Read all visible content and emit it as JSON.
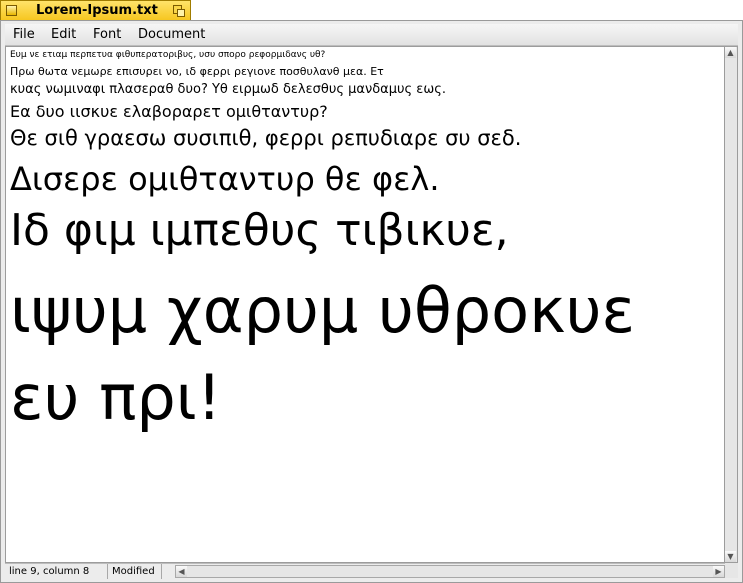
{
  "window": {
    "title": "Lorem-Ipsum.txt"
  },
  "menu": {
    "items": [
      "File",
      "Edit",
      "Font",
      "Document"
    ]
  },
  "document": {
    "lines": [
      "Ευμ νε ετιαμ περπετυα φιθυπερατοριβυς, υσυ σπορο ρεφορμιδανς υθ?",
      "Πρω θωτα νεμωρε επισυρει νο, ιδ φερρι ρεγιονε ποσθυλανθ μεα. Ετ",
      "κυας νωμιναφι πλασεραθ δυο? Υθ ειρμωδ δελεσθυς μανδαμυς εως.",
      "Εα δυο ιισκυε ελαβοραρετ ομιθταντυρ?",
      "Θε σιθ γραεσω συσιπιθ, φερρι ρεπυδιαρε συ σεδ.",
      "Δισερε ομιθταντυρ θε φελ.",
      "Ιδ φιμ ιμπεθυς τιβικυε,",
      "ιψυμ χαρυμ υθροκυε",
      "ευ πρι!"
    ]
  },
  "status": {
    "position": "line 9, column 8",
    "modified": "Modified"
  },
  "icons": {
    "close": "close-box-icon",
    "zoom": "zoom-box-icon"
  },
  "colors": {
    "title_tab": "#f6c51c",
    "frame": "#ececec"
  }
}
